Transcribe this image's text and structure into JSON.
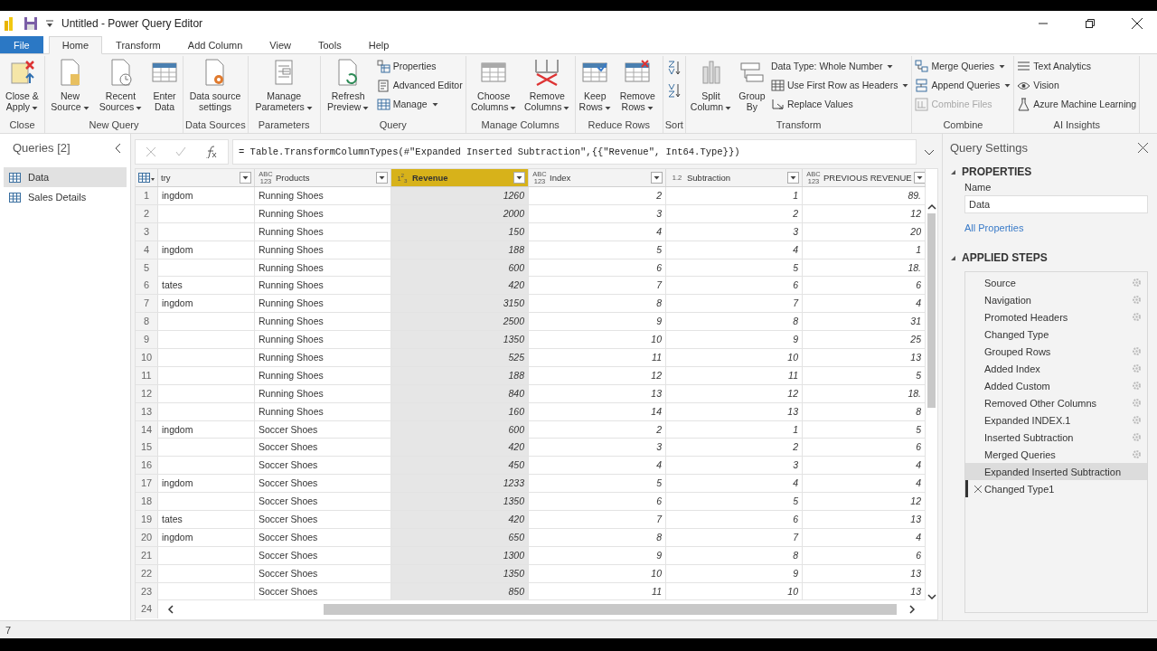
{
  "window": {
    "title": "Untitled - Power Query Editor"
  },
  "tabs": [
    {
      "label": "File",
      "kind": "file",
      "selected": false
    },
    {
      "label": "Home",
      "kind": "tab",
      "selected": true
    },
    {
      "label": "Transform",
      "kind": "tab",
      "selected": false
    },
    {
      "label": "Add Column",
      "kind": "tab",
      "selected": false
    },
    {
      "label": "View",
      "kind": "tab",
      "selected": false
    },
    {
      "label": "Tools",
      "kind": "tab",
      "selected": false
    },
    {
      "label": "Help",
      "kind": "tab",
      "selected": false
    }
  ],
  "ribbon": [
    {
      "label": "Close",
      "items": [
        {
          "kind": "large",
          "label": "Close & Apply",
          "dropdown": true
        }
      ]
    },
    {
      "label": "New Query",
      "items": [
        {
          "kind": "large",
          "label": "New Source",
          "dropdown": true
        },
        {
          "kind": "large",
          "label": "Recent Sources",
          "dropdown": true
        },
        {
          "kind": "large",
          "label": "Enter Data",
          "dropdown": false
        }
      ]
    },
    {
      "label": "Data Sources",
      "items": [
        {
          "kind": "large",
          "label": "Data source settings",
          "dropdown": false
        }
      ]
    },
    {
      "label": "Parameters",
      "items": [
        {
          "kind": "large",
          "label": "Manage Parameters",
          "dropdown": true
        }
      ]
    },
    {
      "label": "Query",
      "items": [
        {
          "kind": "large",
          "label": "Refresh Preview",
          "dropdown": true
        },
        {
          "kind": "small",
          "label": "Properties",
          "dropdown": false
        },
        {
          "kind": "small",
          "label": "Advanced Editor",
          "dropdown": false
        },
        {
          "kind": "small",
          "label": "Manage",
          "dropdown": true
        }
      ]
    },
    {
      "label": "Manage Columns",
      "items": [
        {
          "kind": "large",
          "label": "Choose Columns",
          "dropdown": true
        },
        {
          "kind": "large",
          "label": "Remove Columns",
          "dropdown": true
        }
      ]
    },
    {
      "label": "Reduce Rows",
      "items": [
        {
          "kind": "large",
          "label": "Keep Rows",
          "dropdown": true
        },
        {
          "kind": "large",
          "label": "Remove Rows",
          "dropdown": true
        }
      ]
    },
    {
      "label": "Sort",
      "items": [
        {
          "kind": "ascending"
        },
        {
          "kind": "descending"
        }
      ]
    },
    {
      "label": "Transform",
      "items": [
        {
          "kind": "large",
          "label": "Split Column",
          "dropdown": true
        },
        {
          "kind": "large",
          "label": "Group By",
          "dropdown": false
        },
        {
          "kind": "small",
          "label": "Data Type: Whole Number",
          "dropdown": true
        },
        {
          "kind": "small",
          "label": "Use First Row as Headers",
          "dropdown": true
        },
        {
          "kind": "small",
          "label": "Replace Values",
          "dropdown": false
        }
      ]
    },
    {
      "label": "Combine",
      "items": [
        {
          "kind": "small",
          "label": "Merge Queries",
          "dropdown": true,
          "disabled": false
        },
        {
          "kind": "small",
          "label": "Append Queries",
          "dropdown": true,
          "disabled": false
        },
        {
          "kind": "small",
          "label": "Combine Files",
          "dropdown": false,
          "disabled": true
        }
      ]
    },
    {
      "label": "AI Insights",
      "items": [
        {
          "kind": "small",
          "label": "Text Analytics",
          "dropdown": false
        },
        {
          "kind": "small",
          "label": "Vision",
          "dropdown": false
        },
        {
          "kind": "small",
          "label": "Azure Machine Learning",
          "dropdown": false
        }
      ]
    }
  ],
  "queries": {
    "title": "Queries [2]",
    "items": [
      {
        "label": "Data",
        "selected": true
      },
      {
        "label": "Sales Details",
        "selected": false
      }
    ]
  },
  "formula": "= Table.TransformColumnTypes(#\"Expanded Inserted Subtraction\",{{\"Revenue\", Int64.Type}})",
  "table": {
    "columns": [
      {
        "name": "try",
        "kind": "text",
        "selected": false
      },
      {
        "name": "Products",
        "type": "ABC 123",
        "kind": "text",
        "selected": false
      },
      {
        "name": "Revenue",
        "type": "1$^{2}$$_{3}$",
        "kind": "number",
        "selected": true
      },
      {
        "name": "Index",
        "type": "ABC 123",
        "kind": "number",
        "selected": false
      },
      {
        "name": "Subtraction",
        "type": "1.2",
        "kind": "number",
        "selected": false
      },
      {
        "name": "PREVIOUS REVENUE",
        "type": "ABC 123",
        "kind": "number",
        "selected": false
      }
    ],
    "rows": [
      {
        "n": "1",
        "cells": [
          "ingdom",
          "Running Shoes",
          "1260",
          "2",
          "1",
          "89."
        ]
      },
      {
        "n": "2",
        "cells": [
          null,
          "Running Shoes",
          "2000",
          "3",
          "2",
          "12"
        ]
      },
      {
        "n": "3",
        "cells": [
          null,
          "Running Shoes",
          "150",
          "4",
          "3",
          "20"
        ]
      },
      {
        "n": "4",
        "cells": [
          "ingdom",
          "Running Shoes",
          "188",
          "5",
          "4",
          "1"
        ]
      },
      {
        "n": "5",
        "cells": [
          null,
          "Running Shoes",
          "600",
          "6",
          "5",
          "18."
        ]
      },
      {
        "n": "6",
        "cells": [
          "tates",
          "Running Shoes",
          "420",
          "7",
          "6",
          "6"
        ]
      },
      {
        "n": "7",
        "cells": [
          "ingdom",
          "Running Shoes",
          "3150",
          "8",
          "7",
          "4"
        ]
      },
      {
        "n": "8",
        "cells": [
          null,
          "Running Shoes",
          "2500",
          "9",
          "8",
          "31"
        ]
      },
      {
        "n": "9",
        "cells": [
          null,
          "Running Shoes",
          "1350",
          "10",
          "9",
          "25"
        ]
      },
      {
        "n": "10",
        "cells": [
          null,
          "Running Shoes",
          "525",
          "11",
          "10",
          "13"
        ]
      },
      {
        "n": "11",
        "cells": [
          null,
          "Running Shoes",
          "188",
          "12",
          "11",
          "5"
        ]
      },
      {
        "n": "12",
        "cells": [
          null,
          "Running Shoes",
          "840",
          "13",
          "12",
          "18."
        ]
      },
      {
        "n": "13",
        "cells": [
          null,
          "Running Shoes",
          "160",
          "14",
          "13",
          "8"
        ]
      },
      {
        "n": "14",
        "cells": [
          "ingdom",
          "Soccer Shoes",
          "600",
          "2",
          "1",
          "5"
        ]
      },
      {
        "n": "15",
        "cells": [
          null,
          "Soccer Shoes",
          "420",
          "3",
          "2",
          "6"
        ]
      },
      {
        "n": "16",
        "cells": [
          null,
          "Soccer Shoes",
          "450",
          "4",
          "3",
          "4"
        ]
      },
      {
        "n": "17",
        "cells": [
          "ingdom",
          "Soccer Shoes",
          "1233",
          "5",
          "4",
          "4"
        ]
      },
      {
        "n": "18",
        "cells": [
          null,
          "Soccer Shoes",
          "1350",
          "6",
          "5",
          "12"
        ]
      },
      {
        "n": "19",
        "cells": [
          "tates",
          "Soccer Shoes",
          "420",
          "7",
          "6",
          "13"
        ]
      },
      {
        "n": "20",
        "cells": [
          "ingdom",
          "Soccer Shoes",
          "650",
          "8",
          "7",
          "4"
        ]
      },
      {
        "n": "21",
        "cells": [
          null,
          "Soccer Shoes",
          "1300",
          "9",
          "8",
          "6"
        ]
      },
      {
        "n": "22",
        "cells": [
          null,
          "Soccer Shoes",
          "1350",
          "10",
          "9",
          "13"
        ]
      },
      {
        "n": "23",
        "cells": [
          null,
          "Soccer Shoes",
          "850",
          "11",
          "10",
          "13"
        ]
      }
    ],
    "last_row_number": "24"
  },
  "settings": {
    "title": "Query Settings",
    "properties_heading": "PROPERTIES",
    "name_label": "Name",
    "name_value": "Data",
    "link": "All Properties",
    "steps_heading": "APPLIED STEPS",
    "steps": [
      {
        "label": "Source",
        "gear": true,
        "selected": false,
        "deletable": false
      },
      {
        "label": "Navigation",
        "gear": true,
        "selected": false,
        "deletable": false
      },
      {
        "label": "Promoted Headers",
        "gear": true,
        "selected": false,
        "deletable": false
      },
      {
        "label": "Changed Type",
        "gear": false,
        "selected": false,
        "deletable": false
      },
      {
        "label": "Grouped Rows",
        "gear": true,
        "selected": false,
        "deletable": false
      },
      {
        "label": "Added Index",
        "gear": true,
        "selected": false,
        "deletable": false
      },
      {
        "label": "Added Custom",
        "gear": true,
        "selected": false,
        "deletable": false
      },
      {
        "label": "Removed Other Columns",
        "gear": true,
        "selected": false,
        "deletable": false
      },
      {
        "label": "Expanded INDEX.1",
        "gear": true,
        "selected": false,
        "deletable": false
      },
      {
        "label": "Inserted Subtraction",
        "gear": true,
        "selected": false,
        "deletable": false
      },
      {
        "label": "Merged Queries",
        "gear": true,
        "selected": false,
        "deletable": false
      },
      {
        "label": "Expanded Inserted Subtraction",
        "gear": false,
        "selected": true,
        "deletable": false
      },
      {
        "label": "Changed Type1",
        "gear": false,
        "selected": false,
        "deletable": true
      }
    ]
  },
  "status_bar": {
    "text": "7"
  }
}
